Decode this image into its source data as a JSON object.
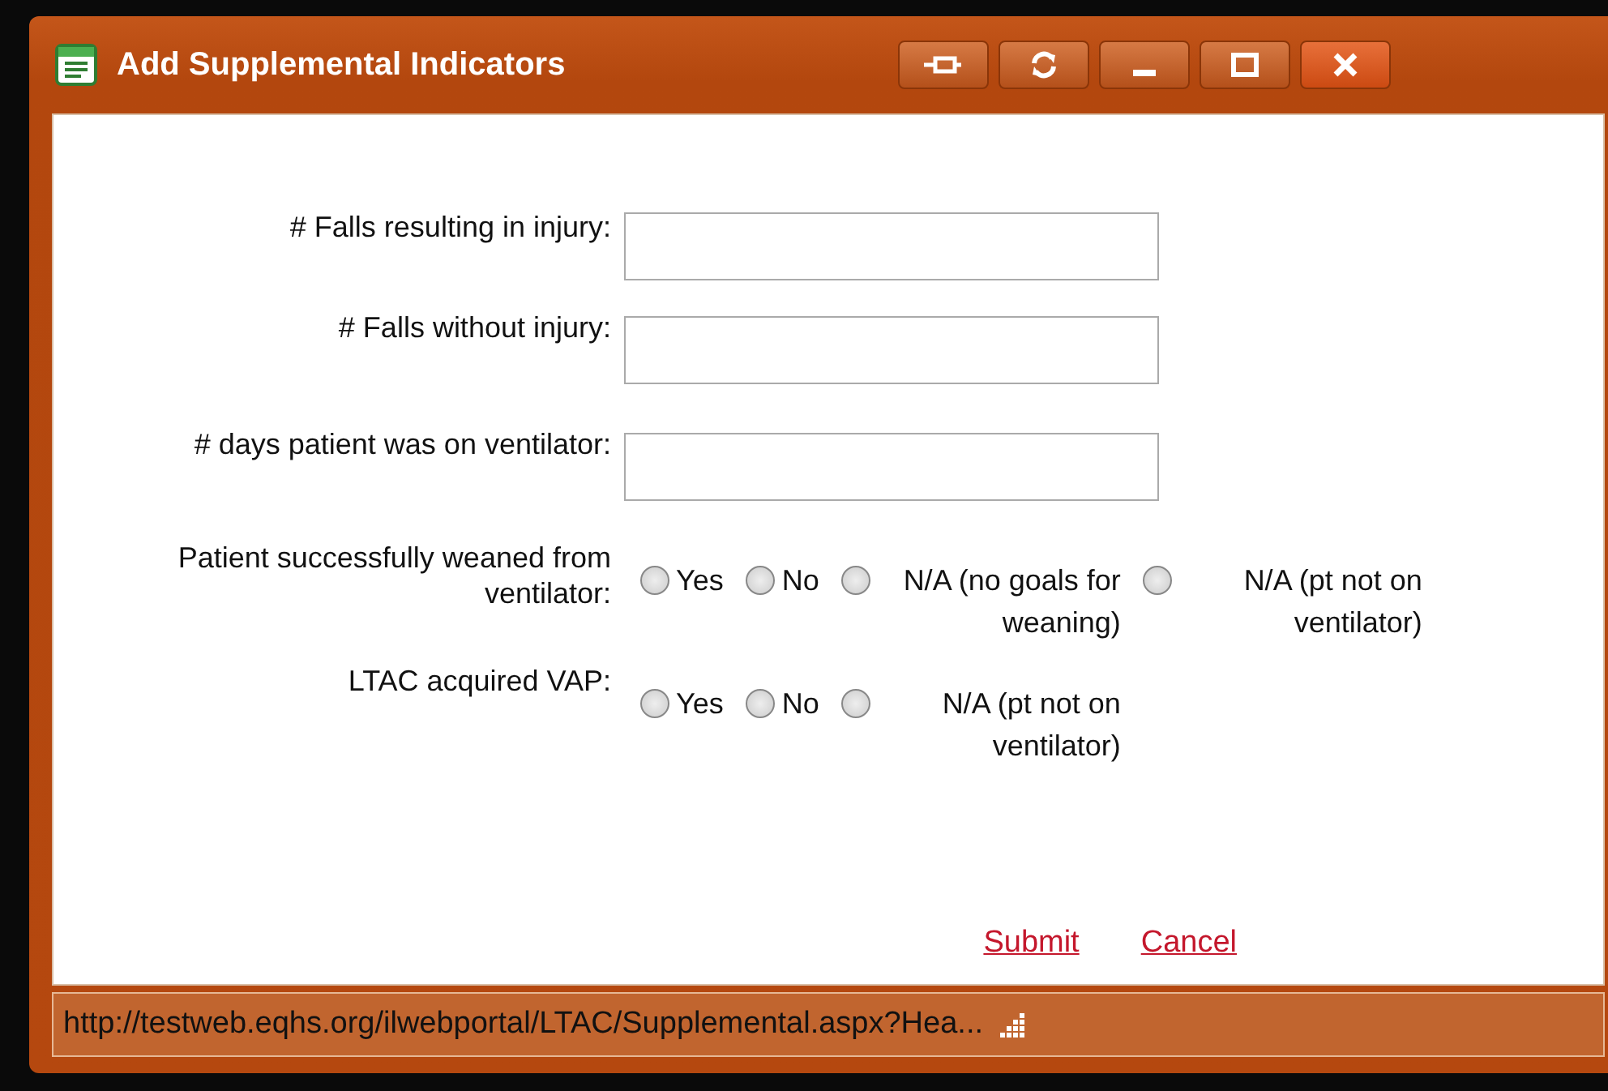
{
  "window": {
    "title": "Add Supplemental Indicators"
  },
  "fields": [
    {
      "label": "# Falls resulting in injury:"
    },
    {
      "label": "# Falls without injury:"
    },
    {
      "label": "# days patient was on ventilator:"
    }
  ],
  "questions": [
    {
      "label": "Patient successfully weaned from ventilator:",
      "options": [
        {
          "label": "Yes",
          "selected": false
        },
        {
          "label": "No",
          "selected": false
        },
        {
          "label": "N/A (no goals for weaning)",
          "selected": false
        },
        {
          "label": "N/A (pt not on ventilator)",
          "selected": false
        }
      ]
    },
    {
      "label": "LTAC acquired VAP:",
      "options": [
        {
          "label": "Yes",
          "selected": false
        },
        {
          "label": "No",
          "selected": false
        },
        {
          "label": "N/A (pt not on ventilator)",
          "selected": false
        }
      ]
    }
  ],
  "links": [
    "Submit",
    "Cancel"
  ],
  "status_bar": {
    "url": "http://testweb.eqhs.org/ilwebportal/LTAC/Supplemental.aspx?Hea..."
  }
}
